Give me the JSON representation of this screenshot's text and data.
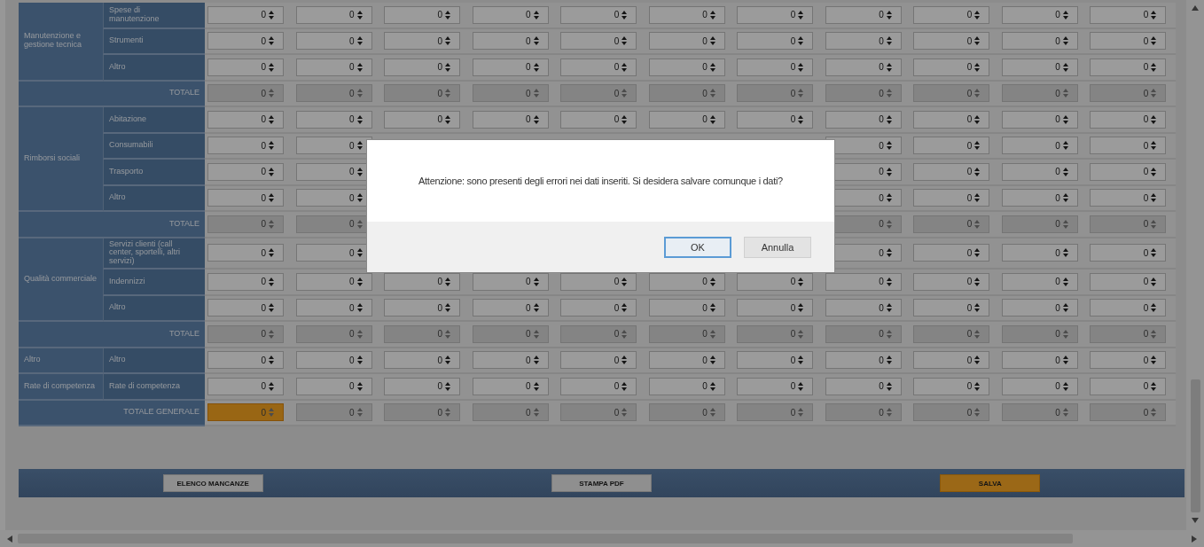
{
  "table": {
    "groups": [
      {
        "label": "Manutenzione e gestione tecnica",
        "rows": [
          {
            "label": "Spese di manutenzione",
            "values": [
              "0",
              "0",
              "0",
              "0",
              "0",
              "0",
              "0",
              "0",
              "0",
              "0",
              "0"
            ]
          },
          {
            "label": "Strumenti",
            "values": [
              "0",
              "0",
              "0",
              "0",
              "0",
              "0",
              "0",
              "0",
              "0",
              "0",
              "0"
            ]
          },
          {
            "label": "Altro",
            "values": [
              "0",
              "0",
              "0",
              "0",
              "0",
              "0",
              "0",
              "0",
              "0",
              "0",
              "0"
            ]
          }
        ],
        "total": {
          "label": "TOTALE",
          "values": [
            "0",
            "0",
            "0",
            "0",
            "0",
            "0",
            "0",
            "0",
            "0",
            "0",
            "0"
          ]
        }
      },
      {
        "label": "Rimborsi sociali",
        "rows": [
          {
            "label": "Abitazione",
            "values": [
              "0",
              "0",
              "0",
              "0",
              "0",
              "0",
              "0",
              "0",
              "0",
              "0",
              "0"
            ]
          },
          {
            "label": "Consumabili",
            "left_values": [
              "0",
              "0"
            ],
            "right_values": [
              "0",
              "0",
              "0",
              "0"
            ]
          },
          {
            "label": "Trasporto",
            "left_values": [
              "0",
              "0"
            ],
            "right_values": [
              "0",
              "0",
              "0",
              "0"
            ]
          },
          {
            "label": "Altro",
            "left_values": [
              "0",
              "0"
            ],
            "right_values": [
              "0",
              "0",
              "0",
              "0"
            ]
          }
        ],
        "total": {
          "label": "TOTALE",
          "left_values": [
            "0",
            "0"
          ],
          "right_values": [
            "0",
            "0",
            "0",
            "0"
          ]
        }
      },
      {
        "label": "Qualità commerciale",
        "rows": [
          {
            "label": "Servizi clienti (call center, sportelli, altri servizi)",
            "left_values": [
              "0",
              "0"
            ],
            "right_values": [
              "0",
              "0",
              "0",
              "0"
            ]
          },
          {
            "label": "Indennizzi",
            "values": [
              "0",
              "0",
              "0",
              "0",
              "0",
              "0",
              "0",
              "0",
              "0",
              "0",
              "0"
            ]
          },
          {
            "label": "Altro",
            "values": [
              "0",
              "0",
              "0",
              "0",
              "0",
              "0",
              "0",
              "0",
              "0",
              "0",
              "0"
            ]
          }
        ],
        "total": {
          "label": "TOTALE",
          "values": [
            "0",
            "0",
            "0",
            "0",
            "0",
            "0",
            "0",
            "0",
            "0",
            "0",
            "0"
          ]
        }
      },
      {
        "label": "Altro",
        "rows": [
          {
            "label": "Altro",
            "values": [
              "0",
              "0",
              "0",
              "0",
              "0",
              "0",
              "0",
              "0",
              "0",
              "0",
              "0"
            ]
          }
        ]
      },
      {
        "label": "Rate di competenza",
        "rows": [
          {
            "label": "Rate di competenza",
            "values": [
              "0",
              "0",
              "0",
              "0",
              "0",
              "0",
              "0",
              "0",
              "0",
              "0",
              "0"
            ]
          }
        ]
      }
    ],
    "grand_total": {
      "label": "TOTALE GENERALE",
      "cells": [
        {
          "value": "0",
          "highlighted": true
        },
        {
          "value": "0",
          "highlighted": false
        },
        {
          "value": "0",
          "highlighted": false
        },
        {
          "value": "0",
          "highlighted": false
        },
        {
          "value": "0",
          "highlighted": false
        },
        {
          "value": "0",
          "highlighted": false
        },
        {
          "value": "0",
          "highlighted": false
        },
        {
          "value": "0",
          "highlighted": false
        },
        {
          "value": "0",
          "highlighted": false
        },
        {
          "value": "0",
          "highlighted": false
        },
        {
          "value": "0",
          "highlighted": false
        }
      ]
    }
  },
  "buttons": [
    {
      "label": "ELENCO MANCANZE",
      "kind": "secondary"
    },
    {
      "label": "STAMPA PDF",
      "kind": "secondary"
    },
    {
      "label": "SALVA",
      "kind": "primary"
    }
  ],
  "dialog": {
    "message": "Attenzione: sono presenti degli errori nei dati inseriti. Si desidera salvare comunque i dati?",
    "buttons": [
      {
        "label": "OK",
        "focused": true
      },
      {
        "label": "Annulla",
        "focused": false
      }
    ]
  }
}
